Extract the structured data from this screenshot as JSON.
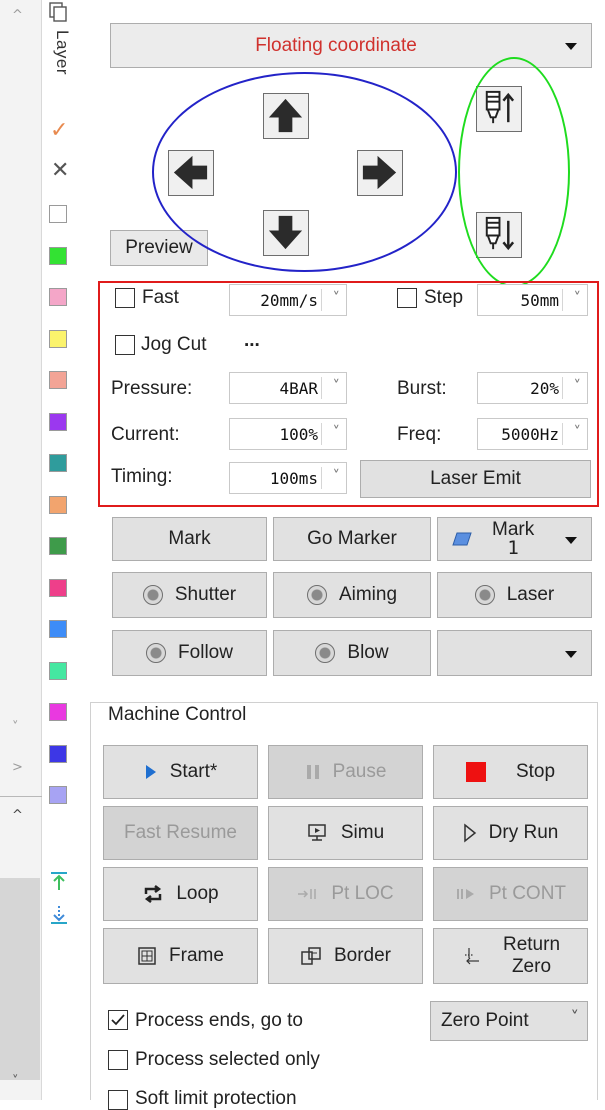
{
  "layer_panel": {
    "tab_label": "Layer",
    "layer_colors": [
      "#ffffff",
      "#33e233",
      "#f4a6c8",
      "#fbf36c",
      "#f3a496",
      "#9b38ef",
      "#2f9c9c",
      "#f2a46e",
      "#3e9b4a",
      "#ee3f8a",
      "#3d8cf7",
      "#45e7a1",
      "#e939e0",
      "#3d37e6",
      "#a7a3f3"
    ]
  },
  "floating_coordinate": {
    "label": "Floating coordinate"
  },
  "preview": {
    "label": "Preview"
  },
  "jog": {
    "fast_label": "Fast",
    "fast_speed": "20mm/s",
    "step_label": "Step",
    "step_value": "50mm",
    "jog_cut_label": "Jog Cut",
    "jog_cut_more": "..."
  },
  "laser_params": {
    "pressure_label": "Pressure:",
    "pressure_value": "4BAR",
    "burst_label": "Burst:",
    "burst_value": "20%",
    "current_label": "Current:",
    "current_value": "100%",
    "freq_label": "Freq:",
    "freq_value": "5000Hz",
    "timing_label": "Timing:",
    "timing_value": "100ms",
    "laser_emit_label": "Laser Emit"
  },
  "mark_row": {
    "mark": "Mark",
    "go_marker": "Go Marker",
    "mark1_line1": "Mark",
    "mark1_line2": "1"
  },
  "toggles": {
    "shutter": "Shutter",
    "aiming": "Aiming",
    "laser": "Laser",
    "follow": "Follow",
    "blow": "Blow"
  },
  "machine_control": {
    "title": "Machine Control",
    "start": "Start*",
    "pause": "Pause",
    "stop": "Stop",
    "fast_resume": "Fast Resume",
    "simu": "Simu",
    "dry_run": "Dry Run",
    "loop": "Loop",
    "pt_loc": "Pt LOC",
    "pt_cont": "Pt CONT",
    "frame": "Frame",
    "border": "Border",
    "return_zero_line1": "Return",
    "return_zero_line2": "Zero"
  },
  "process": {
    "ends_label": "Process ends, go to",
    "ends_checked": true,
    "ends_target": "Zero Point",
    "selected_only_label": "Process selected only",
    "soft_limit_label": "Soft limit protection"
  },
  "colors": {
    "annotation_blue": "#2323c8",
    "annotation_green": "#1fdc1f",
    "annotation_red": "#e01b1b",
    "floating_text": "#d0312d",
    "stop_red": "#ee1111",
    "start_blue": "#1f6fd0"
  }
}
